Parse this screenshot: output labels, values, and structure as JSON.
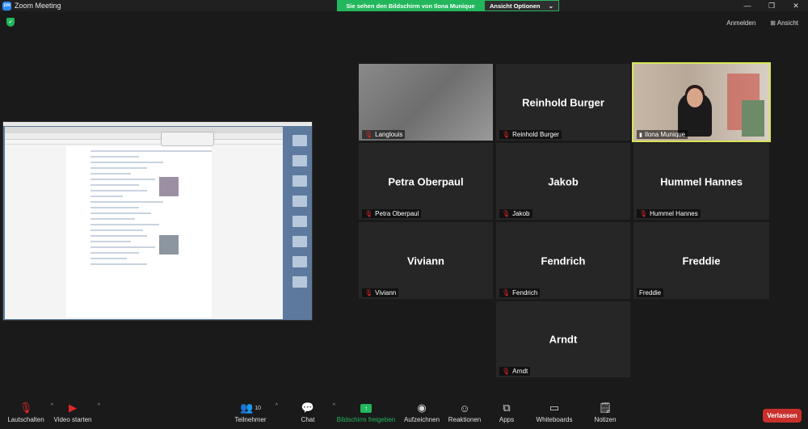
{
  "window": {
    "title": "Zoom Meeting",
    "logo": "zm"
  },
  "share_banner": {
    "text": "Sie sehen den Bildschirm von Ilona Munique",
    "options_label": "Ansicht Optionen"
  },
  "top_right": {
    "signin": "Anmelden",
    "view": "Ansicht"
  },
  "participants": [
    {
      "name": "",
      "label": "Langlouis",
      "muted": true
    },
    {
      "name": "Reinhold Burger",
      "label": "Reinhold Burger",
      "muted": true
    },
    {
      "name": "",
      "label": "Ilona Munique",
      "muted": false
    },
    {
      "name": "Petra Oberpaul",
      "label": "Petra Oberpaul",
      "muted": true
    },
    {
      "name": "Jakob",
      "label": "Jakob",
      "muted": true
    },
    {
      "name": "Hummel Hannes",
      "label": "Hummel Hannes",
      "muted": true
    },
    {
      "name": "Viviann",
      "label": "Viviann",
      "muted": true
    },
    {
      "name": "Fendrich",
      "label": "Fendrich",
      "muted": true
    },
    {
      "name": "Freddie",
      "label": "Freddie",
      "muted": false
    },
    {
      "name": "Arndt",
      "label": "Arndt",
      "muted": true
    }
  ],
  "toolbar": {
    "mute": "Lautschalten",
    "video": "Video starten",
    "participants": "Teilnehmer",
    "participants_count": "10",
    "chat": "Chat",
    "share": "Bildschirm freigeben",
    "record": "Aufzeichnen",
    "reactions": "Reaktionen",
    "apps": "Apps",
    "whiteboards": "Whiteboards",
    "notes": "Notizen",
    "leave": "Verlassen"
  },
  "colors": {
    "accent": "#23b75d",
    "leave": "#c9302c",
    "active_border": "#d6e35a"
  }
}
